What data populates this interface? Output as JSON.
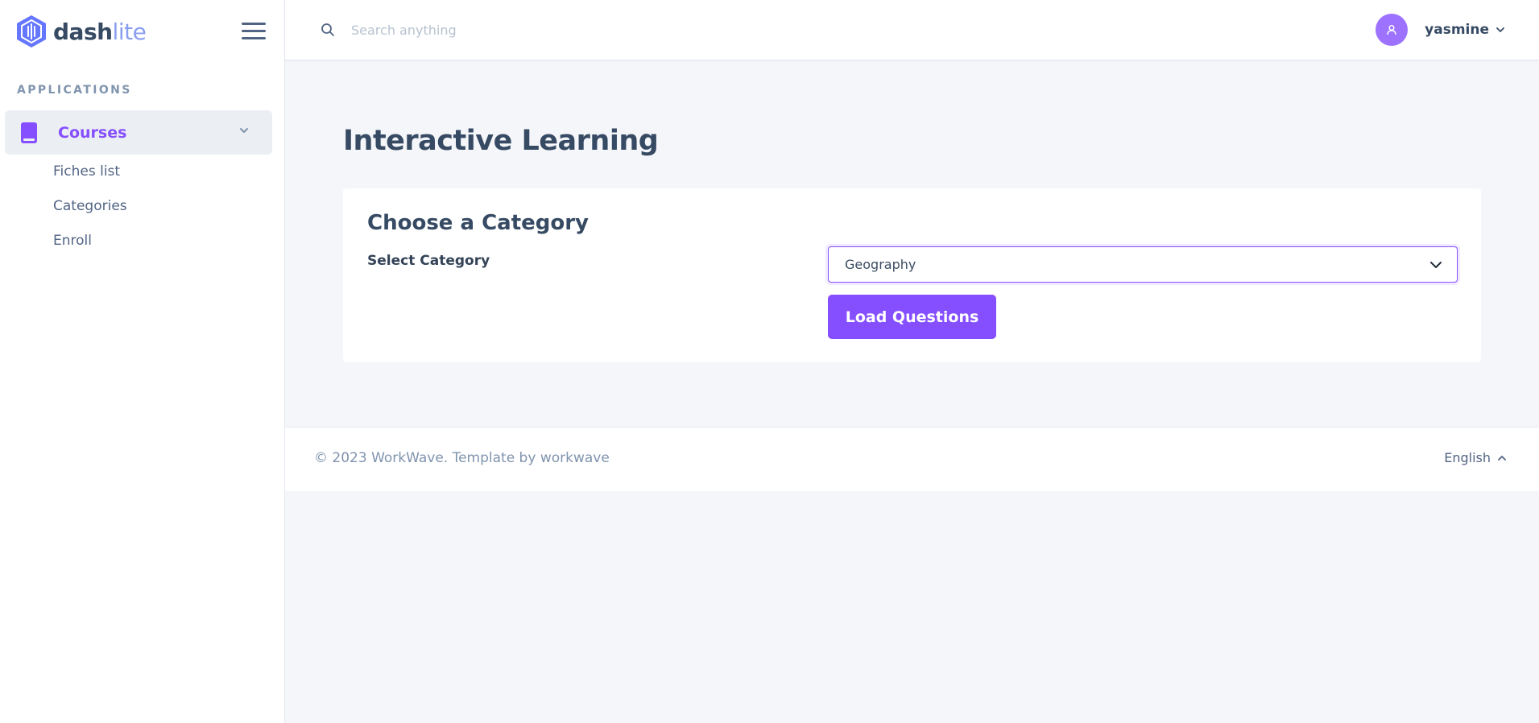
{
  "brand": {
    "name_part1": "dash",
    "name_part2": "lite"
  },
  "sidebar": {
    "section_heading": "APPLICATIONS",
    "active_item": {
      "label": "Courses",
      "icon": "book-icon"
    },
    "sub_items": [
      {
        "label": "Fiches list"
      },
      {
        "label": "Categories"
      },
      {
        "label": "Enroll"
      }
    ]
  },
  "header": {
    "search": {
      "placeholder": "Search anything",
      "value": ""
    },
    "user": {
      "name": "yasmine",
      "icon": "user-icon"
    }
  },
  "main": {
    "page_title": "Interactive Learning",
    "card": {
      "title": "Choose a Category",
      "field_label": "Select Category",
      "selected_value": "Geography",
      "button_label": "Load Questions"
    }
  },
  "footer": {
    "copyright": "© 2023 WorkWave. Template by workwave",
    "language": "English"
  },
  "colors": {
    "accent": "#854fff",
    "avatar": "#9d72ff",
    "text": "#364a63",
    "muted": "#8094ae",
    "background": "#f5f6fa"
  }
}
